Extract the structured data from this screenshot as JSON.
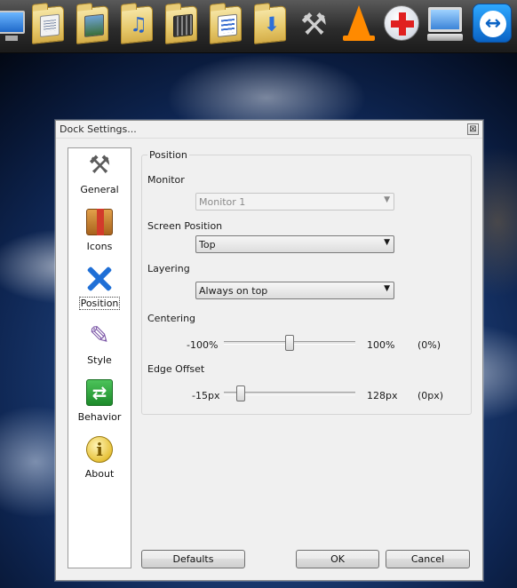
{
  "dock": {
    "items": [
      {
        "name": "My Computer"
      },
      {
        "name": "Documents"
      },
      {
        "name": "Pictures"
      },
      {
        "name": "Music"
      },
      {
        "name": "Videos"
      },
      {
        "name": "Notes"
      },
      {
        "name": "Downloads"
      },
      {
        "name": "Tools"
      },
      {
        "name": "VLC"
      },
      {
        "name": "Medical"
      },
      {
        "name": "Computer"
      },
      {
        "name": "TeamViewer"
      }
    ]
  },
  "dialog": {
    "title": "Dock Settings...",
    "close_glyph": "⊠",
    "nav": [
      {
        "label": "General",
        "icon": "tools-icon"
      },
      {
        "label": "Icons",
        "icon": "package-icon"
      },
      {
        "label": "Position",
        "icon": "position-arrows-icon",
        "active": true
      },
      {
        "label": "Style",
        "icon": "brush-icon"
      },
      {
        "label": "Behavior",
        "icon": "behavior-arrows-icon"
      },
      {
        "label": "About",
        "icon": "info-icon"
      }
    ],
    "group_title": "Position",
    "monitor": {
      "label": "Monitor",
      "value": "Monitor 1",
      "disabled": true
    },
    "screen_position": {
      "label": "Screen Position",
      "value": "Top"
    },
    "layering": {
      "label": "Layering",
      "value": "Always on top"
    },
    "centering": {
      "label": "Centering",
      "min": "-100%",
      "max": "100%",
      "value": "(0%)",
      "fraction": 0.5
    },
    "edge_offset": {
      "label": "Edge Offset",
      "min": "-15px",
      "max": "128px",
      "value": "(0px)",
      "fraction": 0.105
    },
    "buttons": {
      "defaults": "Defaults",
      "ok": "OK",
      "cancel": "Cancel"
    }
  }
}
